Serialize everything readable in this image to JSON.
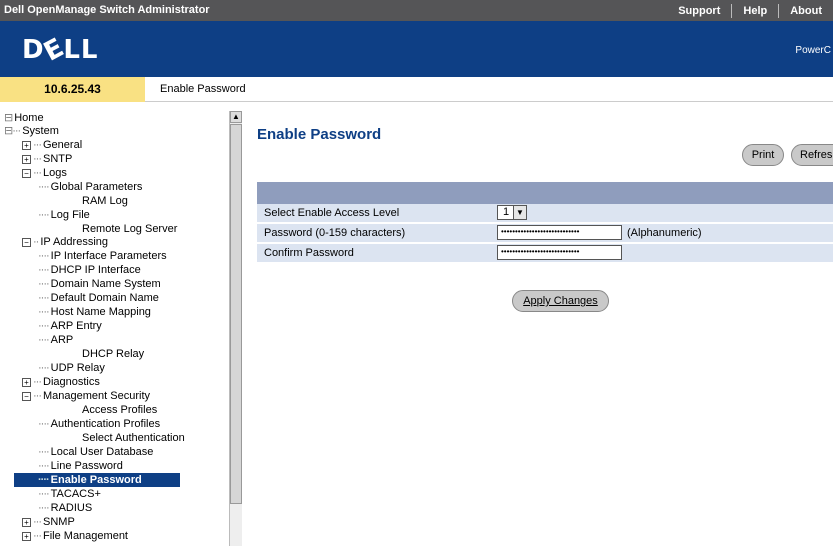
{
  "topbar": {
    "title": "Dell OpenManage Switch Administrator",
    "links": [
      "Support",
      "Help",
      "About"
    ]
  },
  "brand": {
    "logo": "DELL",
    "right_text": "PowerC"
  },
  "ipbar": {
    "ip": "10.6.25.43",
    "breadcrumb": "Enable Password"
  },
  "tree": {
    "items": [
      {
        "label": "Home"
      },
      {
        "label": "System"
      },
      {
        "label": "General"
      },
      {
        "label": "SNTP"
      },
      {
        "label": "Logs"
      },
      {
        "label": "Global Parameters"
      },
      {
        "label": "RAM Log"
      },
      {
        "label": "Log File"
      },
      {
        "label": "Remote Log Server"
      },
      {
        "label": "IP Addressing"
      },
      {
        "label": "IP Interface Parameters"
      },
      {
        "label": "DHCP IP Interface"
      },
      {
        "label": "Domain Name System"
      },
      {
        "label": "Default Domain Name"
      },
      {
        "label": "Host Name Mapping"
      },
      {
        "label": "ARP Entry"
      },
      {
        "label": "ARP"
      },
      {
        "label": "DHCP Relay"
      },
      {
        "label": "UDP Relay"
      },
      {
        "label": "Diagnostics"
      },
      {
        "label": "Management Security"
      },
      {
        "label": "Access Profiles"
      },
      {
        "label": "Authentication Profiles"
      },
      {
        "label": "Select Authentication"
      },
      {
        "label": "Local User Database"
      },
      {
        "label": "Line Password"
      },
      {
        "label": "Enable Password"
      },
      {
        "label": "TACACS+"
      },
      {
        "label": "RADIUS"
      },
      {
        "label": "SNMP"
      },
      {
        "label": "File Management"
      }
    ]
  },
  "main": {
    "title": "Enable Password",
    "print_label": "Print",
    "refresh_label": "Refresh",
    "form": {
      "level_label": "Select Enable Access Level",
      "level_value": "1",
      "password_label": "Password (0-159 characters)",
      "password_value": "••••••••••••••••••••••••••••",
      "password_hint": "(Alphanumeric)",
      "confirm_label": "Confirm Password",
      "confirm_value": "••••••••••••••••••••••••••••"
    },
    "apply_label": "Apply Changes"
  },
  "colors": {
    "brand_blue": "#0e3f85",
    "ip_yellow": "#f9e183",
    "form_header": "#8f9dbd",
    "form_row": "#dce4f1"
  }
}
